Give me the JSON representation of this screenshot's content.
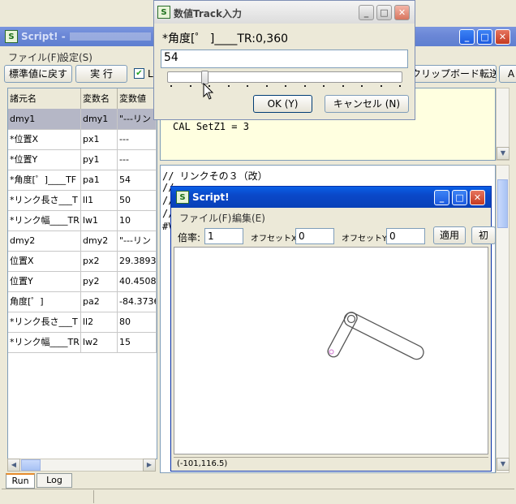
{
  "main_window": {
    "title": "Script! -",
    "menu": [
      "ファイル(F)",
      "設定(S)"
    ],
    "toolbar": {
      "reset_label": "標準値に戻す",
      "run_label": "実 行",
      "checkbox_label": "L",
      "clipboard_label": "クリップボード転送",
      "extra_label": "A"
    },
    "table": {
      "headers": [
        "諸元名",
        "変数名",
        "変数値"
      ],
      "rows": [
        [
          "dmy1",
          "dmy1",
          "\"---リン"
        ],
        [
          "*位置X",
          "px1",
          "---"
        ],
        [
          "*位置Y",
          "py1",
          "---"
        ],
        [
          "*角度[゜]____TF",
          "pa1",
          "54"
        ],
        [
          "*リンク長さ___T",
          "ll1",
          "50"
        ],
        [
          "*リンク幅____TR",
          "lw1",
          "10"
        ],
        [
          "dmy2",
          "dmy2",
          "\"---リン"
        ],
        [
          "位置X",
          "px2",
          "29.3893"
        ],
        [
          "位置Y",
          "py2",
          "40.4508"
        ],
        [
          "角度[゜]",
          "pa2",
          "-84.3736"
        ],
        [
          "*リンク長さ___T",
          "ll2",
          "80"
        ],
        [
          "*リンク幅____TR",
          "lw2",
          "15"
        ]
      ]
    },
    "tabs": [
      "Run",
      "Log"
    ],
    "code_top": "CAL SetZ1 = 3",
    "code_lines": [
      "// リンクその３（改）",
      "//",
      "//",
      "//",
      "#V"
    ]
  },
  "track_dialog": {
    "title": "数値Track入力",
    "prompt": "*角度[゜ ]____TR:0,360",
    "value": "54",
    "slider_value": 54,
    "slider_min": 0,
    "slider_max": 360,
    "ok_label": "OK (Y)",
    "cancel_label": "キャンセル (N)"
  },
  "script_window": {
    "title": "Script!",
    "menu": [
      "ファイル(F)",
      "編集(E)"
    ],
    "scale_label": "倍率:",
    "scale_value": "1",
    "offset_x_label": "オフセットX:",
    "offset_x_value": "0",
    "offset_y_label": "オフセットY:",
    "offset_y_value": "0",
    "apply_label": "適用",
    "init_label": "初",
    "status": "(-101,116.5)"
  },
  "colors": {
    "titlebar": "#0a48c8",
    "code_bg": "#ffffe0",
    "selected_row": "#b5b7c6",
    "link_stroke": "#555555"
  }
}
